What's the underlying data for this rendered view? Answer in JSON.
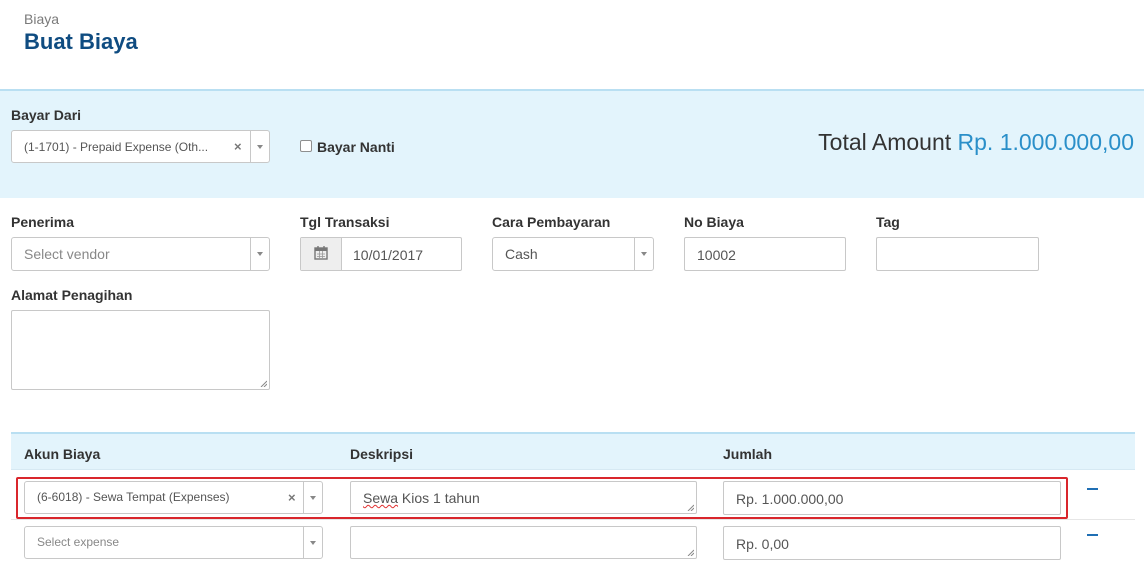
{
  "header": {
    "breadcrumb": "Biaya",
    "title": "Buat Biaya"
  },
  "payment": {
    "bayar_dari_label": "Bayar Dari",
    "bayar_dari_value": "(1-1701) - Prepaid Expense (Oth...",
    "bayar_nanti_label": "Bayar Nanti",
    "bayar_nanti_checked": false,
    "total_label": "Total Amount",
    "total_value": "Rp. 1.000.000,00"
  },
  "form": {
    "penerima_label": "Penerima",
    "penerima_placeholder": "Select vendor",
    "tgl_label": "Tgl Transaksi",
    "tgl_value": "10/01/2017",
    "cara_label": "Cara Pembayaran",
    "cara_value": "Cash",
    "no_label": "No Biaya",
    "no_value": "10002",
    "tag_label": "Tag",
    "tag_value": "",
    "alamat_label": "Alamat Penagihan",
    "alamat_value": ""
  },
  "table": {
    "headers": [
      "Akun Biaya",
      "Deskripsi",
      "Jumlah"
    ],
    "rows": [
      {
        "akun": "(6-6018) - Sewa Tempat (Expenses)",
        "deskripsi_word1": "Sewa",
        "deskripsi_rest": " Kios 1 tahun",
        "jumlah": "Rp. 1.000.000,00",
        "highlighted": true
      },
      {
        "akun": "Select expense",
        "deskripsi_word1": "",
        "deskripsi_rest": "",
        "jumlah": "Rp. 0,00",
        "highlighted": false
      }
    ]
  },
  "colors": {
    "title": "#0f4c81",
    "accent": "#2a8fc9",
    "band": "#e3f4fc",
    "highlight_border": "#d9262c"
  }
}
